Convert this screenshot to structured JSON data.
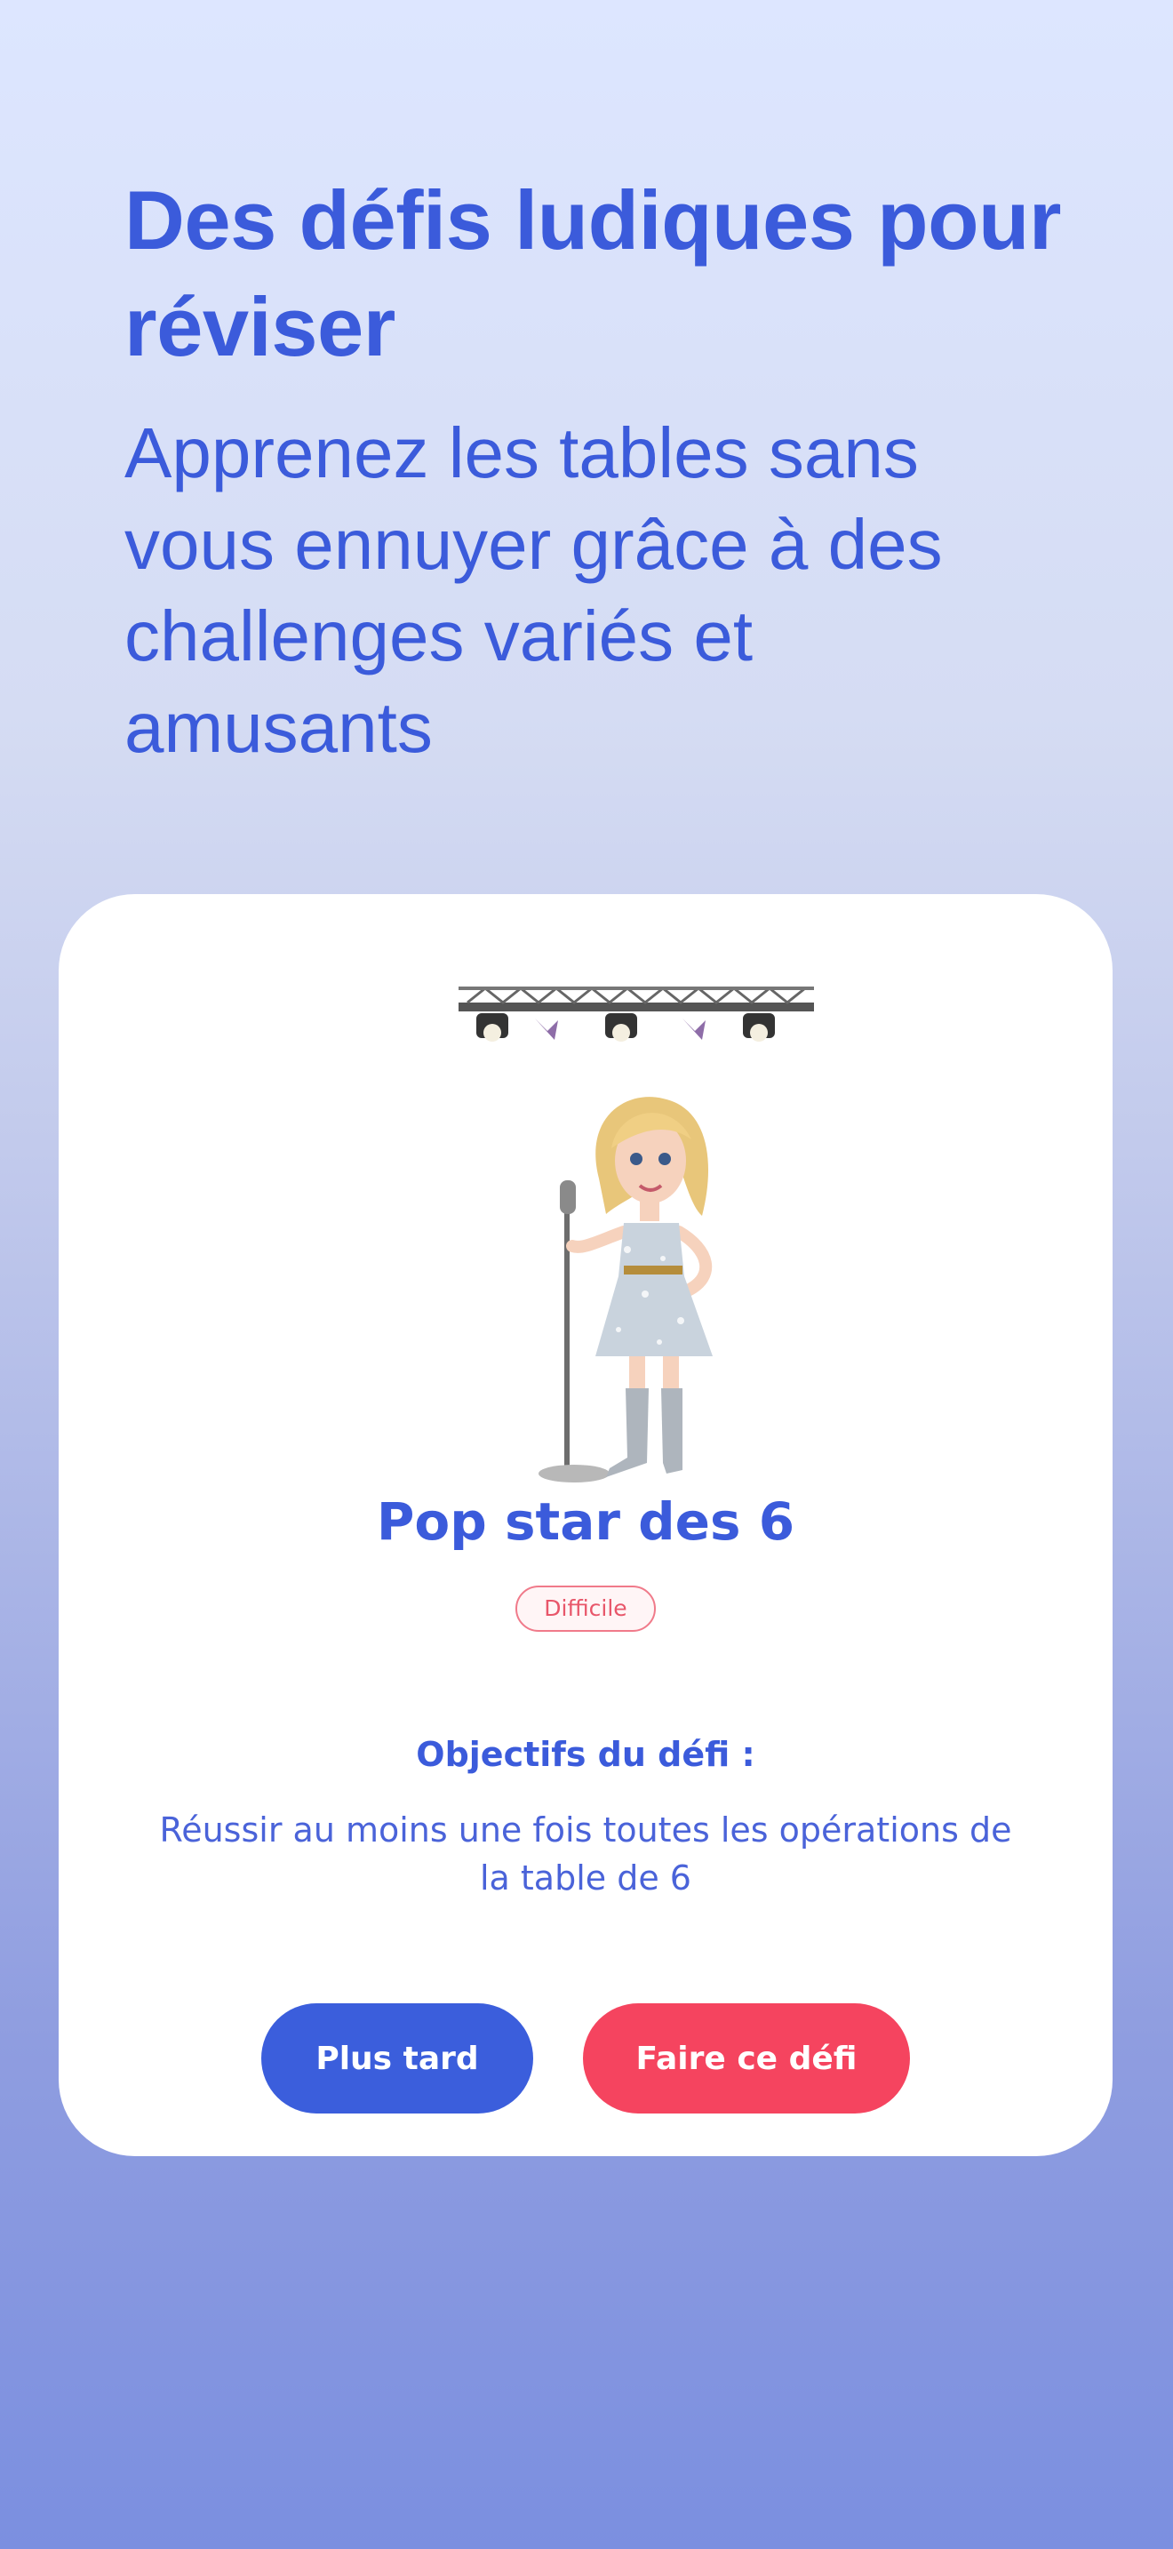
{
  "hero": {
    "title": "Des défis ludiques pour réviser",
    "subtitle": "Apprenez les tables sans vous ennuyer grâce à des challenges variés et amusants"
  },
  "challenge": {
    "title": "Pop star des 6",
    "difficulty": "Difficile",
    "objectives_heading": "Objectifs du défi :",
    "objectives_text": "Réussir au moins une fois toutes les opérations de la table de 6",
    "illustration": "pop-star-singer-illustration"
  },
  "actions": {
    "later_label": "Plus tard",
    "do_label": "Faire ce défi"
  },
  "colors": {
    "accent_blue": "#3b5bdb",
    "accent_red": "#f5445f",
    "badge_red": "#e8566a"
  }
}
